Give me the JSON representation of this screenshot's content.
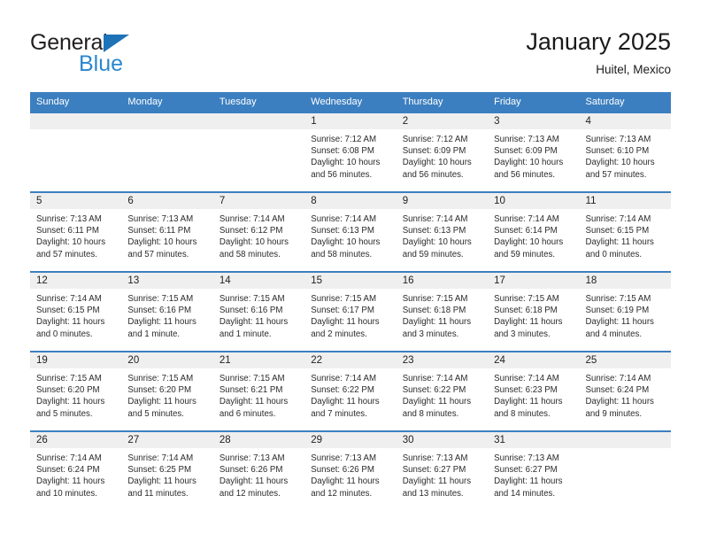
{
  "logo": {
    "word1": "General",
    "word2": "Blue",
    "triangle_color": "#1e72b8",
    "word2_color": "#2b87cf",
    "word1_color": "#231f20"
  },
  "header": {
    "title": "January 2025",
    "subtitle": "Huitel, Mexico"
  },
  "colors": {
    "header_row": "#3c7fc0",
    "daynum_band": "#efefef",
    "row_divider": "#3c7fc0",
    "text": "#2b2b2b"
  },
  "weekday_headers": [
    "Sunday",
    "Monday",
    "Tuesday",
    "Wednesday",
    "Thursday",
    "Friday",
    "Saturday"
  ],
  "labels": {
    "sunrise": "Sunrise:",
    "sunset": "Sunset:",
    "daylight": "Daylight:"
  },
  "weeks": [
    [
      {
        "day": "",
        "empty": true
      },
      {
        "day": "",
        "empty": true
      },
      {
        "day": "",
        "empty": true
      },
      {
        "day": "1",
        "sunrise": "Sunrise: 7:12 AM",
        "sunset": "Sunset: 6:08 PM",
        "daylight": "Daylight: 10 hours and 56 minutes."
      },
      {
        "day": "2",
        "sunrise": "Sunrise: 7:12 AM",
        "sunset": "Sunset: 6:09 PM",
        "daylight": "Daylight: 10 hours and 56 minutes."
      },
      {
        "day": "3",
        "sunrise": "Sunrise: 7:13 AM",
        "sunset": "Sunset: 6:09 PM",
        "daylight": "Daylight: 10 hours and 56 minutes."
      },
      {
        "day": "4",
        "sunrise": "Sunrise: 7:13 AM",
        "sunset": "Sunset: 6:10 PM",
        "daylight": "Daylight: 10 hours and 57 minutes."
      }
    ],
    [
      {
        "day": "5",
        "sunrise": "Sunrise: 7:13 AM",
        "sunset": "Sunset: 6:11 PM",
        "daylight": "Daylight: 10 hours and 57 minutes."
      },
      {
        "day": "6",
        "sunrise": "Sunrise: 7:13 AM",
        "sunset": "Sunset: 6:11 PM",
        "daylight": "Daylight: 10 hours and 57 minutes."
      },
      {
        "day": "7",
        "sunrise": "Sunrise: 7:14 AM",
        "sunset": "Sunset: 6:12 PM",
        "daylight": "Daylight: 10 hours and 58 minutes."
      },
      {
        "day": "8",
        "sunrise": "Sunrise: 7:14 AM",
        "sunset": "Sunset: 6:13 PM",
        "daylight": "Daylight: 10 hours and 58 minutes."
      },
      {
        "day": "9",
        "sunrise": "Sunrise: 7:14 AM",
        "sunset": "Sunset: 6:13 PM",
        "daylight": "Daylight: 10 hours and 59 minutes."
      },
      {
        "day": "10",
        "sunrise": "Sunrise: 7:14 AM",
        "sunset": "Sunset: 6:14 PM",
        "daylight": "Daylight: 10 hours and 59 minutes."
      },
      {
        "day": "11",
        "sunrise": "Sunrise: 7:14 AM",
        "sunset": "Sunset: 6:15 PM",
        "daylight": "Daylight: 11 hours and 0 minutes."
      }
    ],
    [
      {
        "day": "12",
        "sunrise": "Sunrise: 7:14 AM",
        "sunset": "Sunset: 6:15 PM",
        "daylight": "Daylight: 11 hours and 0 minutes."
      },
      {
        "day": "13",
        "sunrise": "Sunrise: 7:15 AM",
        "sunset": "Sunset: 6:16 PM",
        "daylight": "Daylight: 11 hours and 1 minute."
      },
      {
        "day": "14",
        "sunrise": "Sunrise: 7:15 AM",
        "sunset": "Sunset: 6:16 PM",
        "daylight": "Daylight: 11 hours and 1 minute."
      },
      {
        "day": "15",
        "sunrise": "Sunrise: 7:15 AM",
        "sunset": "Sunset: 6:17 PM",
        "daylight": "Daylight: 11 hours and 2 minutes."
      },
      {
        "day": "16",
        "sunrise": "Sunrise: 7:15 AM",
        "sunset": "Sunset: 6:18 PM",
        "daylight": "Daylight: 11 hours and 3 minutes."
      },
      {
        "day": "17",
        "sunrise": "Sunrise: 7:15 AM",
        "sunset": "Sunset: 6:18 PM",
        "daylight": "Daylight: 11 hours and 3 minutes."
      },
      {
        "day": "18",
        "sunrise": "Sunrise: 7:15 AM",
        "sunset": "Sunset: 6:19 PM",
        "daylight": "Daylight: 11 hours and 4 minutes."
      }
    ],
    [
      {
        "day": "19",
        "sunrise": "Sunrise: 7:15 AM",
        "sunset": "Sunset: 6:20 PM",
        "daylight": "Daylight: 11 hours and 5 minutes."
      },
      {
        "day": "20",
        "sunrise": "Sunrise: 7:15 AM",
        "sunset": "Sunset: 6:20 PM",
        "daylight": "Daylight: 11 hours and 5 minutes."
      },
      {
        "day": "21",
        "sunrise": "Sunrise: 7:15 AM",
        "sunset": "Sunset: 6:21 PM",
        "daylight": "Daylight: 11 hours and 6 minutes."
      },
      {
        "day": "22",
        "sunrise": "Sunrise: 7:14 AM",
        "sunset": "Sunset: 6:22 PM",
        "daylight": "Daylight: 11 hours and 7 minutes."
      },
      {
        "day": "23",
        "sunrise": "Sunrise: 7:14 AM",
        "sunset": "Sunset: 6:22 PM",
        "daylight": "Daylight: 11 hours and 8 minutes."
      },
      {
        "day": "24",
        "sunrise": "Sunrise: 7:14 AM",
        "sunset": "Sunset: 6:23 PM",
        "daylight": "Daylight: 11 hours and 8 minutes."
      },
      {
        "day": "25",
        "sunrise": "Sunrise: 7:14 AM",
        "sunset": "Sunset: 6:24 PM",
        "daylight": "Daylight: 11 hours and 9 minutes."
      }
    ],
    [
      {
        "day": "26",
        "sunrise": "Sunrise: 7:14 AM",
        "sunset": "Sunset: 6:24 PM",
        "daylight": "Daylight: 11 hours and 10 minutes."
      },
      {
        "day": "27",
        "sunrise": "Sunrise: 7:14 AM",
        "sunset": "Sunset: 6:25 PM",
        "daylight": "Daylight: 11 hours and 11 minutes."
      },
      {
        "day": "28",
        "sunrise": "Sunrise: 7:13 AM",
        "sunset": "Sunset: 6:26 PM",
        "daylight": "Daylight: 11 hours and 12 minutes."
      },
      {
        "day": "29",
        "sunrise": "Sunrise: 7:13 AM",
        "sunset": "Sunset: 6:26 PM",
        "daylight": "Daylight: 11 hours and 12 minutes."
      },
      {
        "day": "30",
        "sunrise": "Sunrise: 7:13 AM",
        "sunset": "Sunset: 6:27 PM",
        "daylight": "Daylight: 11 hours and 13 minutes."
      },
      {
        "day": "31",
        "sunrise": "Sunrise: 7:13 AM",
        "sunset": "Sunset: 6:27 PM",
        "daylight": "Daylight: 11 hours and 14 minutes."
      },
      {
        "day": "",
        "empty": true
      }
    ]
  ]
}
